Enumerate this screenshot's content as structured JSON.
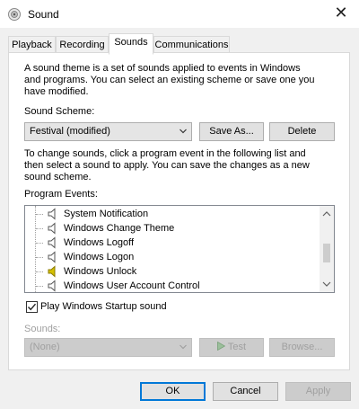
{
  "window": {
    "title": "Sound",
    "close_glyph": "✕"
  },
  "tabs": [
    {
      "label": "Playback",
      "active": false
    },
    {
      "label": "Recording",
      "active": false
    },
    {
      "label": "Sounds",
      "active": true
    },
    {
      "label": "Communications",
      "active": false
    }
  ],
  "sounds_tab": {
    "intro_lines": [
      "A sound theme is a set of sounds applied to events in Windows",
      "and programs.  You can select an existing scheme or save one you",
      "have modified."
    ],
    "scheme_label": "Sound Scheme:",
    "scheme_value": "Festival (modified)",
    "save_as_label": "Save As...",
    "delete_label": "Delete",
    "change_lines": [
      "To change sounds, click a program event in the following list and",
      "then select a sound to apply.  You can save the changes as a new",
      "sound scheme."
    ],
    "program_events_label": "Program Events:",
    "events": [
      {
        "label": "System Notification",
        "has_sound": false
      },
      {
        "label": "Windows Change Theme",
        "has_sound": false
      },
      {
        "label": "Windows Logoff",
        "has_sound": false
      },
      {
        "label": "Windows Logon",
        "has_sound": false
      },
      {
        "label": "Windows Unlock",
        "has_sound": true
      },
      {
        "label": "Windows User Account Control",
        "has_sound": false
      }
    ],
    "play_startup_label": "Play Windows Startup sound",
    "play_startup_checked": true,
    "sounds_label": "Sounds:",
    "sounds_value": "(None)",
    "test_label": "Test",
    "browse_label": "Browse..."
  },
  "footer": {
    "ok_label": "OK",
    "cancel_label": "Cancel",
    "apply_label": "Apply"
  },
  "colors": {
    "accent": "#0078d7",
    "sound_icon_active": "#d4c000",
    "disabled_text": "#a0a0a0"
  },
  "icons": [
    "speaker-icon",
    "close-icon",
    "chevron-down-icon",
    "checkmark-icon",
    "play-icon"
  ]
}
